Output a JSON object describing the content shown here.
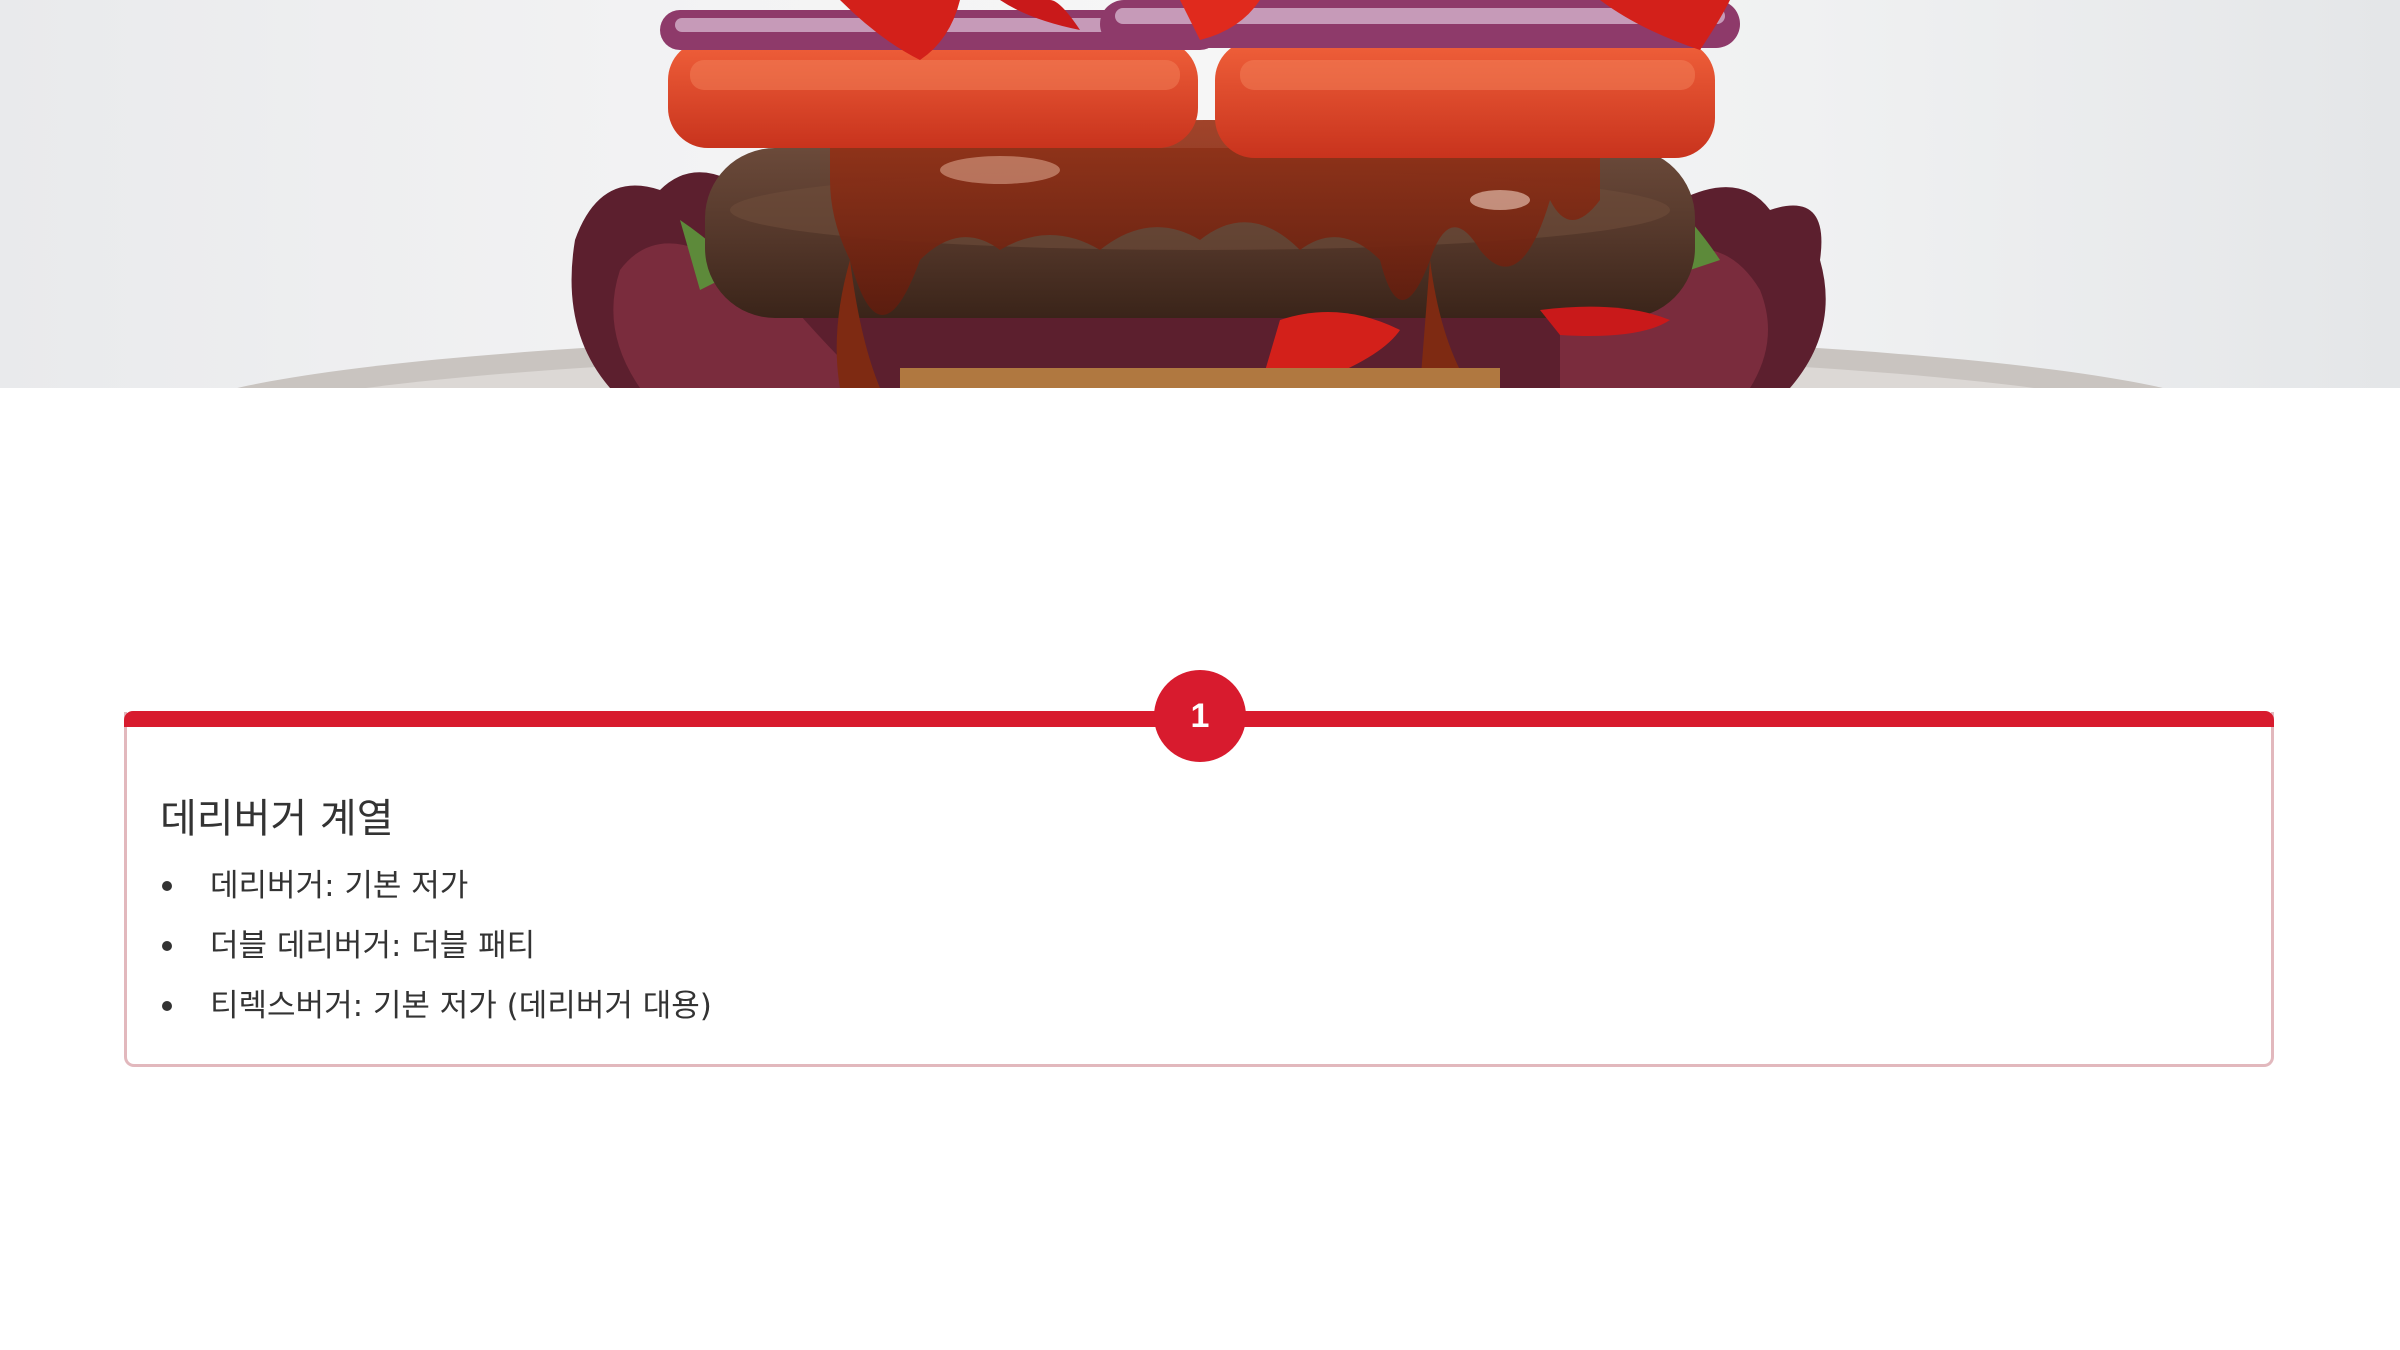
{
  "hero": {
    "image": "burger-photo",
    "colors": {
      "background": "#eeeff0",
      "tomato": "#e2452a",
      "patty": "#5a3a2c",
      "onion": "#8e3a6a",
      "lettuce": "#6b2a3a"
    }
  },
  "section": {
    "number": "1",
    "title": "데리버거 계열",
    "items": [
      "데리버거: 기본 저가",
      "더블 데리버거: 더블 패티",
      "티렉스버거: 기본 저가 (데리버거 대용)"
    ],
    "accent_color": "#d81b2e",
    "border_color": "#e2b8bd"
  }
}
